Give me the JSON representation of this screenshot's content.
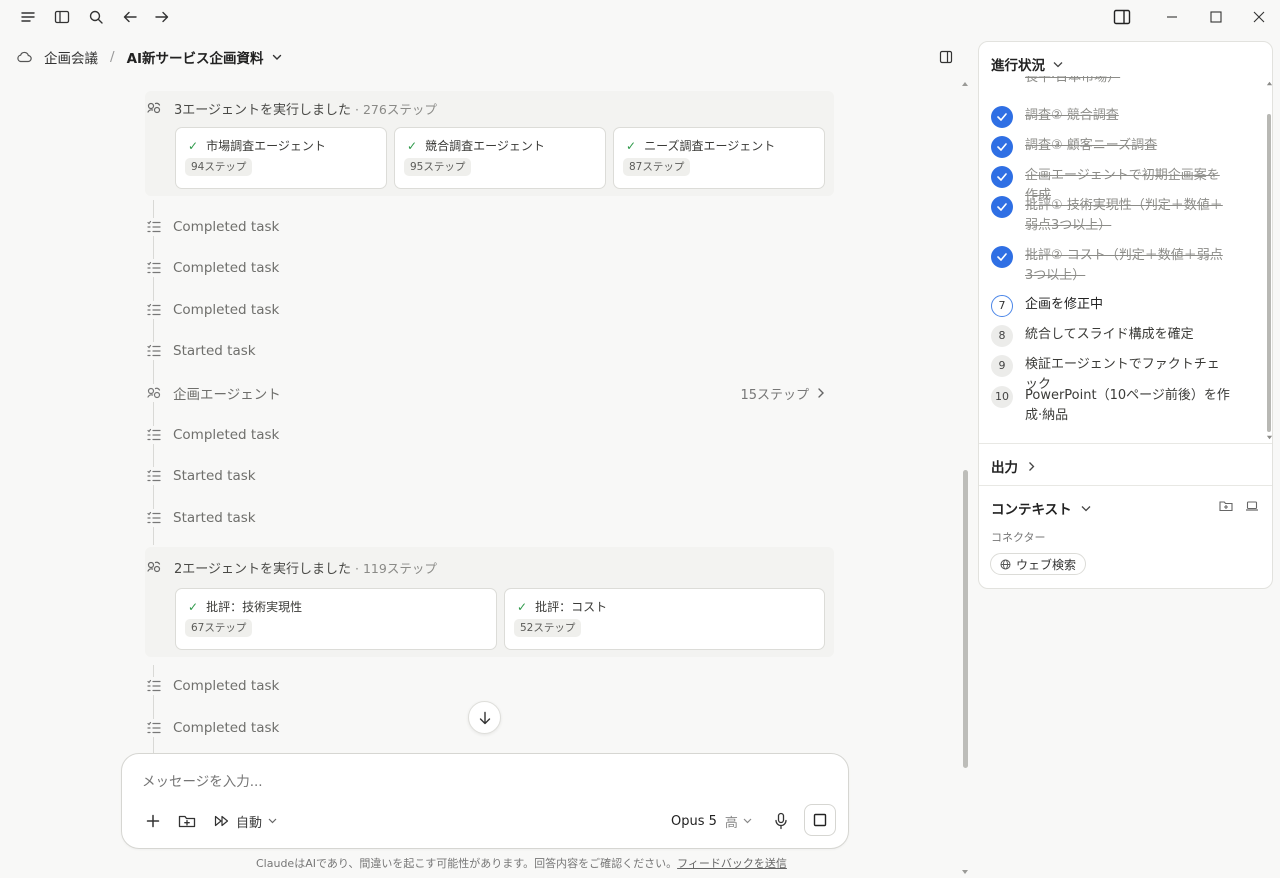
{
  "breadcrumb": {
    "project": "企画会議",
    "separator": "/",
    "page": "AI新サービス企画資料"
  },
  "timeline": {
    "group1": {
      "title": "3エージェントを実行しました",
      "steps": "· 276ステップ",
      "agents": [
        {
          "name": "市場調査エージェント",
          "steps": "94ステップ"
        },
        {
          "name": "競合調査エージェント",
          "steps": "95ステップ"
        },
        {
          "name": "ニーズ調査エージェント",
          "steps": "87ステップ"
        }
      ]
    },
    "rows_a": [
      "Completed task",
      "Completed task",
      "Completed task",
      "Started task"
    ],
    "agent_row": {
      "name": "企画エージェント",
      "steps": "15ステップ"
    },
    "rows_b": [
      "Completed task",
      "Started task",
      "Started task"
    ],
    "group2": {
      "title": "2エージェントを実行しました",
      "steps": "· 119ステップ",
      "agents": [
        {
          "name": "批評：技術実現性",
          "steps": "67ステップ"
        },
        {
          "name": "批評：コスト",
          "steps": "52ステップ"
        }
      ]
    },
    "rows_c": [
      "Completed task",
      "Completed task"
    ]
  },
  "composer": {
    "placeholder": "メッセージを入力...",
    "mode_label": "自動",
    "model": "Opus 5",
    "effort": "高"
  },
  "footer": {
    "disclaimer": "ClaudeはAIであり、間違いを起こす可能性があります。回答内容をご確認ください。",
    "feedback_link": "フィードバックを送信"
  },
  "panel": {
    "progress_title": "進行状況",
    "steps": [
      {
        "label": "長平·日本市場）",
        "status": "done"
      },
      {
        "label": "調査② 競合調査",
        "status": "done"
      },
      {
        "label": "調査③ 顧客ニーズ調査",
        "status": "done"
      },
      {
        "label": "企画エージェントで初期企画案を作成",
        "status": "done"
      },
      {
        "label": "批評① 技術実現性（判定＋数値＋弱点3つ以上）",
        "status": "done"
      },
      {
        "label": "批評② コスト（判定＋数値＋弱点3つ以上）",
        "status": "done"
      },
      {
        "num": "7",
        "label": "企画を修正中",
        "status": "current"
      },
      {
        "num": "8",
        "label": "統合してスライド構成を確定",
        "status": "todo"
      },
      {
        "num": "9",
        "label": "検証エージェントでファクトチェック",
        "status": "todo"
      },
      {
        "num": "10",
        "label": "PowerPoint（10ページ前後）を作成·納品",
        "status": "todo"
      }
    ],
    "output_title": "出力",
    "context_title": "コンテキスト",
    "connector_label": "コネクター",
    "connector_chip": "ウェブ検索"
  },
  "colors": {
    "accent": "#2f6fe4",
    "check": "#2f9a4b"
  }
}
